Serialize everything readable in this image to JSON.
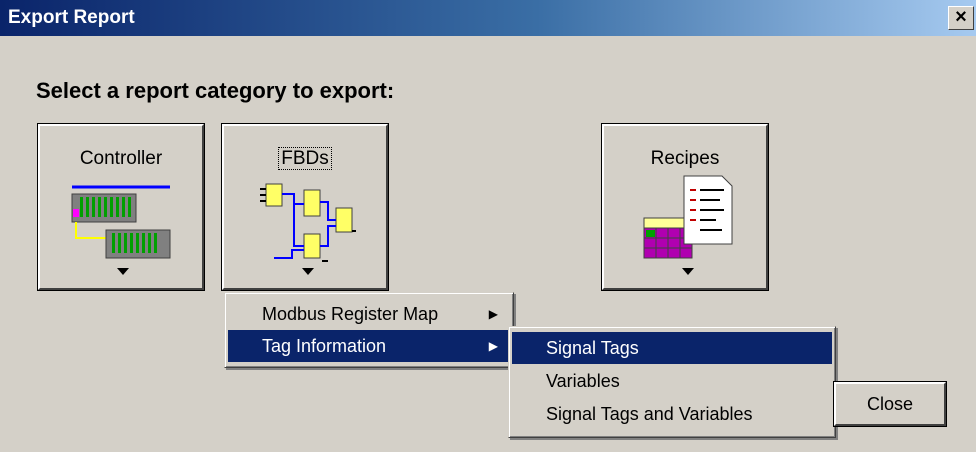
{
  "window": {
    "title": "Export Report",
    "close_glyph": "×"
  },
  "prompt": "Select a report category to export:",
  "categories": [
    {
      "label": "Controller",
      "icon": "controller-rack-icon"
    },
    {
      "label": "FBDs",
      "icon": "function-block-diagram-icon"
    },
    {
      "label": "Recipes",
      "icon": "recipes-spreadsheet-icon"
    }
  ],
  "menu": {
    "items": [
      {
        "label": "Modbus Register Map",
        "has_submenu": true,
        "selected": false
      },
      {
        "label": "Tag Information",
        "has_submenu": true,
        "selected": true
      }
    ]
  },
  "submenu": {
    "items": [
      {
        "label": "Signal Tags",
        "selected": true
      },
      {
        "label": "Variables",
        "selected": false
      },
      {
        "label": "Signal Tags and Variables",
        "selected": false
      }
    ]
  },
  "buttons": {
    "close": "Close"
  },
  "colors": {
    "highlight": "#0a246a",
    "face": "#d4d0c8",
    "icon_yellow": "#ffff66"
  }
}
